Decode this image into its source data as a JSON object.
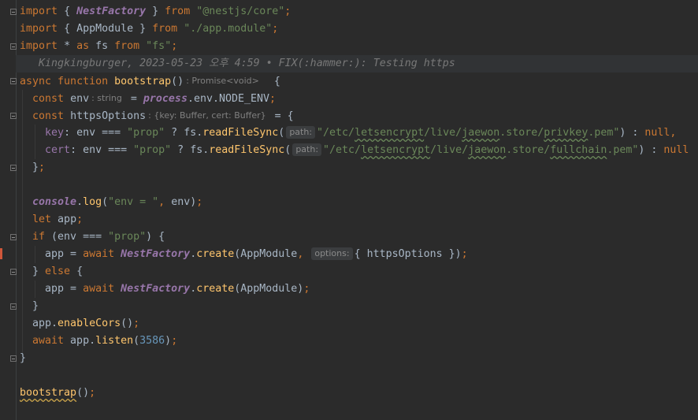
{
  "editor": {
    "line1": {
      "kw": "import",
      "b1": "{ ",
      "cls": "NestFactory",
      "b2": " } ",
      "from": "from",
      "str": "\"@nestjs/core\"",
      "semi": ";"
    },
    "line2": {
      "kw": "import",
      "b1": "{ AppModule } ",
      "from": "from",
      "str": "\"./app.module\"",
      "semi": ";"
    },
    "line3": {
      "kw": "import",
      "star": "* ",
      "as": "as",
      "name": " fs ",
      "from": "from",
      "str": "\"fs\"",
      "semi": ";"
    },
    "blame": "Kingkingburger, 2023-05-23 오후 4:59 • FIX(:hammer:): Testing https",
    "line4": {
      "async": "async",
      "function": "function",
      "fn": "bootstrap",
      "parens": "()",
      "hint": ": Promise<void>",
      "brace": "{"
    },
    "line5": {
      "kw": "const",
      "name": "env",
      "hint": ": string",
      "eq": " = ",
      "process": "process",
      "rest": ".env.NODE_ENV",
      "semi": ";"
    },
    "line6": {
      "kw": "const",
      "name": "httpsOptions",
      "hint": ": {key: Buffer, cert: Buffer}",
      "rest": " = {"
    },
    "line7": {
      "prop": "key",
      "a": ": env === ",
      "str": "\"prop\"",
      "b": " ? fs.",
      "fn": "readFileSync",
      "c": "(",
      "hint": "path:",
      "p1": "\"/etc/",
      "u1": "letsencrypt",
      "p2": "/live/",
      "u2": "jaewon",
      "p3": ".store/",
      "u3": "privkey",
      "p4": ".pem\"",
      "d": ") : ",
      "null": "null",
      "comma": ","
    },
    "line8": {
      "prop": "cert",
      "a": ": env === ",
      "str": "\"prop\"",
      "b": " ? fs.",
      "fn": "readFileSync",
      "c": "(",
      "hint": "path:",
      "p1": "\"/etc/",
      "u1": "letsencrypt",
      "p2": "/live/",
      "u2": "jaewon",
      "p3": ".store/",
      "u3": "fullchain",
      "p4": ".pem\"",
      "d": ") : ",
      "null": "null"
    },
    "line9": {
      "brace": "}",
      "semi": ";"
    },
    "line11": {
      "glob": "console",
      "dot": ".",
      "fn": "log",
      "a": "(",
      "str": "\"env = \"",
      "comma": ", ",
      "b": "env)",
      "semi": ";"
    },
    "line12": {
      "kw": "let",
      "rest": " app",
      "semi": ";"
    },
    "line13": {
      "kw": "if",
      "a": " (env === ",
      "str": "\"prop\"",
      "b": ") {"
    },
    "line14": {
      "a": "app = ",
      "kw": "await",
      "cls": "NestFactory",
      "dot": ".",
      "fn": "create",
      "b": "(AppModule",
      "comma": ",",
      "hint": "options:",
      "c": "{ httpsOptions })",
      "semi": ";"
    },
    "line15": {
      "a": "} ",
      "kw": "else",
      "b": " {"
    },
    "line16": {
      "a": "app = ",
      "kw": "await",
      "cls": "NestFactory",
      "dot": ".",
      "fn": "create",
      "b": "(AppModule)",
      "semi": ";"
    },
    "line17": {
      "a": "}"
    },
    "line18": {
      "a": "app.",
      "fn": "enableCors",
      "b": "()",
      "semi": ";"
    },
    "line19": {
      "kw": "await",
      "a": " app.",
      "fn": "listen",
      "b": "(",
      "num": "3586",
      "c": ")",
      "semi": ";"
    },
    "line20": {
      "a": "}"
    },
    "line22": {
      "fn": "bootstrap",
      "a": "()",
      "semi": ";"
    }
  },
  "colors": {
    "background": "#2b2b2b",
    "keyword": "#cc7832",
    "string": "#6a8759",
    "function": "#ffc66d",
    "class": "#9876aa",
    "number": "#6897bb",
    "text": "#a9b7c6"
  }
}
